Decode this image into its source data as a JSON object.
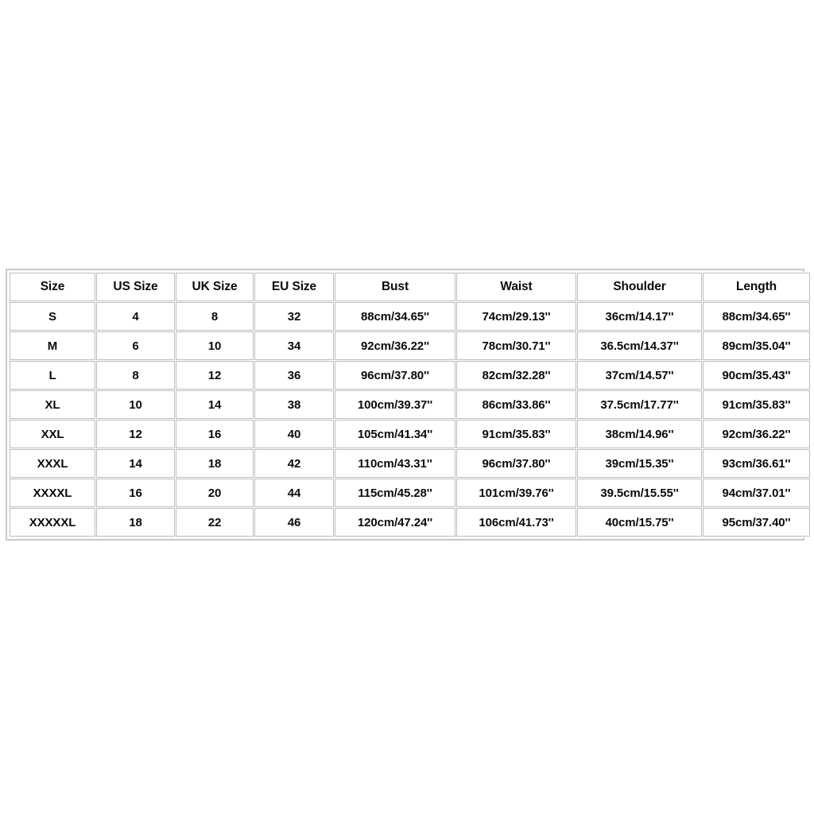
{
  "page": {
    "background_color": "#ffffff",
    "table_border_color": "#c9c9c9",
    "cell_border_color": "#bdbdbd",
    "text_color": "#0b0b0b"
  },
  "table": {
    "headers": [
      "Size",
      "US Size",
      "UK Size",
      "EU Size",
      "Bust",
      "Waist",
      "Shoulder",
      "Length"
    ],
    "rows": [
      {
        "size": "S",
        "us_size": "4",
        "uk_size": "8",
        "eu_size": "32",
        "bust": "88cm/34.65''",
        "waist": "74cm/29.13''",
        "shoulder": "36cm/14.17''",
        "length": "88cm/34.65''"
      },
      {
        "size": "M",
        "us_size": "6",
        "uk_size": "10",
        "eu_size": "34",
        "bust": "92cm/36.22''",
        "waist": "78cm/30.71''",
        "shoulder": "36.5cm/14.37''",
        "length": "89cm/35.04''"
      },
      {
        "size": "L",
        "us_size": "8",
        "uk_size": "12",
        "eu_size": "36",
        "bust": "96cm/37.80''",
        "waist": "82cm/32.28''",
        "shoulder": "37cm/14.57''",
        "length": "90cm/35.43''"
      },
      {
        "size": "XL",
        "us_size": "10",
        "uk_size": "14",
        "eu_size": "38",
        "bust": "100cm/39.37''",
        "waist": "86cm/33.86''",
        "shoulder": "37.5cm/17.77''",
        "length": "91cm/35.83''"
      },
      {
        "size": "XXL",
        "us_size": "12",
        "uk_size": "16",
        "eu_size": "40",
        "bust": "105cm/41.34''",
        "waist": "91cm/35.83''",
        "shoulder": "38cm/14.96''",
        "length": "92cm/36.22''"
      },
      {
        "size": "XXXL",
        "us_size": "14",
        "uk_size": "18",
        "eu_size": "42",
        "bust": "110cm/43.31''",
        "waist": "96cm/37.80''",
        "shoulder": "39cm/15.35''",
        "length": "93cm/36.61''"
      },
      {
        "size": "XXXXL",
        "us_size": "16",
        "uk_size": "20",
        "eu_size": "44",
        "bust": "115cm/45.28''",
        "waist": "101cm/39.76''",
        "shoulder": "39.5cm/15.55''",
        "length": "94cm/37.01''"
      },
      {
        "size": "XXXXXL",
        "us_size": "18",
        "uk_size": "22",
        "eu_size": "46",
        "bust": "120cm/47.24''",
        "waist": "106cm/41.73''",
        "shoulder": "40cm/15.75''",
        "length": "95cm/37.40''"
      }
    ]
  }
}
